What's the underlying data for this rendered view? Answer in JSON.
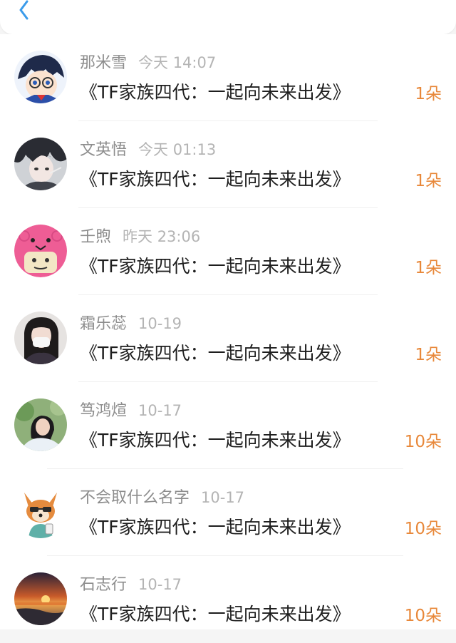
{
  "header": {
    "back_icon": "chevron-left-icon",
    "accent_color": "#3a9bea"
  },
  "gift_color": "#e8883a",
  "items": [
    {
      "name": "那米雪",
      "time": "今天 14:07",
      "title": "《TF家族四代：一起向未来出发》",
      "count": "1朵"
    },
    {
      "name": "文英悟",
      "time": "今天 01:13",
      "title": "《TF家族四代：一起向未来出发》",
      "count": "1朵"
    },
    {
      "name": "壬煦",
      "time": "昨天 23:06",
      "title": "《TF家族四代：一起向未来出发》",
      "count": "1朵"
    },
    {
      "name": "霜乐蕊",
      "time": "10-19",
      "title": "《TF家族四代：一起向未来出发》",
      "count": "1朵"
    },
    {
      "name": "笃鸿煊",
      "time": "10-17",
      "title": "《TF家族四代：一起向未来出发》",
      "count": "10朵"
    },
    {
      "name": "不会取什么名字",
      "time": "10-17",
      "title": "《TF家族四代：一起向未来出发》",
      "count": "10朵"
    },
    {
      "name": "石志行",
      "time": "10-17",
      "title": "《TF家族四代：一起向未来出发》",
      "count": "10朵"
    }
  ]
}
